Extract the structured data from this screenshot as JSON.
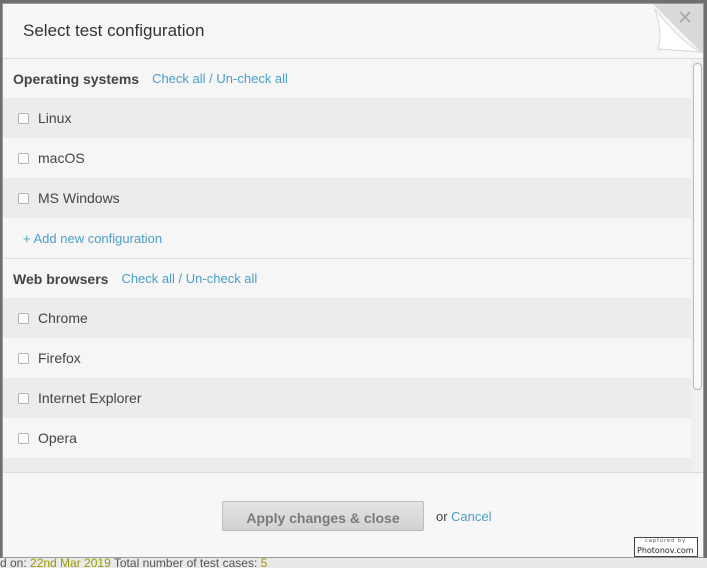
{
  "background": {
    "footer_prefix": "d on: ",
    "footer_date": "22nd Mar 2019",
    "footer_label": " Total number of test cases: ",
    "footer_count": "5"
  },
  "dialog": {
    "title": "Select test configuration",
    "close_glyph": "✕"
  },
  "groups": [
    {
      "title": "Operating systems",
      "check_all": "Check all",
      "separator": "/",
      "uncheck_all": "Un-check all",
      "options": [
        {
          "label": "Linux",
          "checked": false
        },
        {
          "label": "macOS",
          "checked": false
        },
        {
          "label": "MS Windows",
          "checked": false
        }
      ],
      "add_link": "+ Add new configuration"
    },
    {
      "title": "Web browsers",
      "check_all": "Check all",
      "separator": "/",
      "uncheck_all": "Un-check all",
      "options": [
        {
          "label": "Chrome",
          "checked": false
        },
        {
          "label": "Firefox",
          "checked": false
        },
        {
          "label": "Internet Explorer",
          "checked": false
        },
        {
          "label": "Opera",
          "checked": false
        },
        {
          "label": "",
          "checked": false
        }
      ]
    }
  ],
  "footer": {
    "apply_label": "Apply changes & close",
    "or_text": "or",
    "cancel_label": "Cancel"
  },
  "watermark": {
    "top": "captured by",
    "bottom": "Photonov.com"
  },
  "colors": {
    "link": "#4a9fc8",
    "row_shade": "#ececec",
    "row_light": "#f6f6f6"
  }
}
